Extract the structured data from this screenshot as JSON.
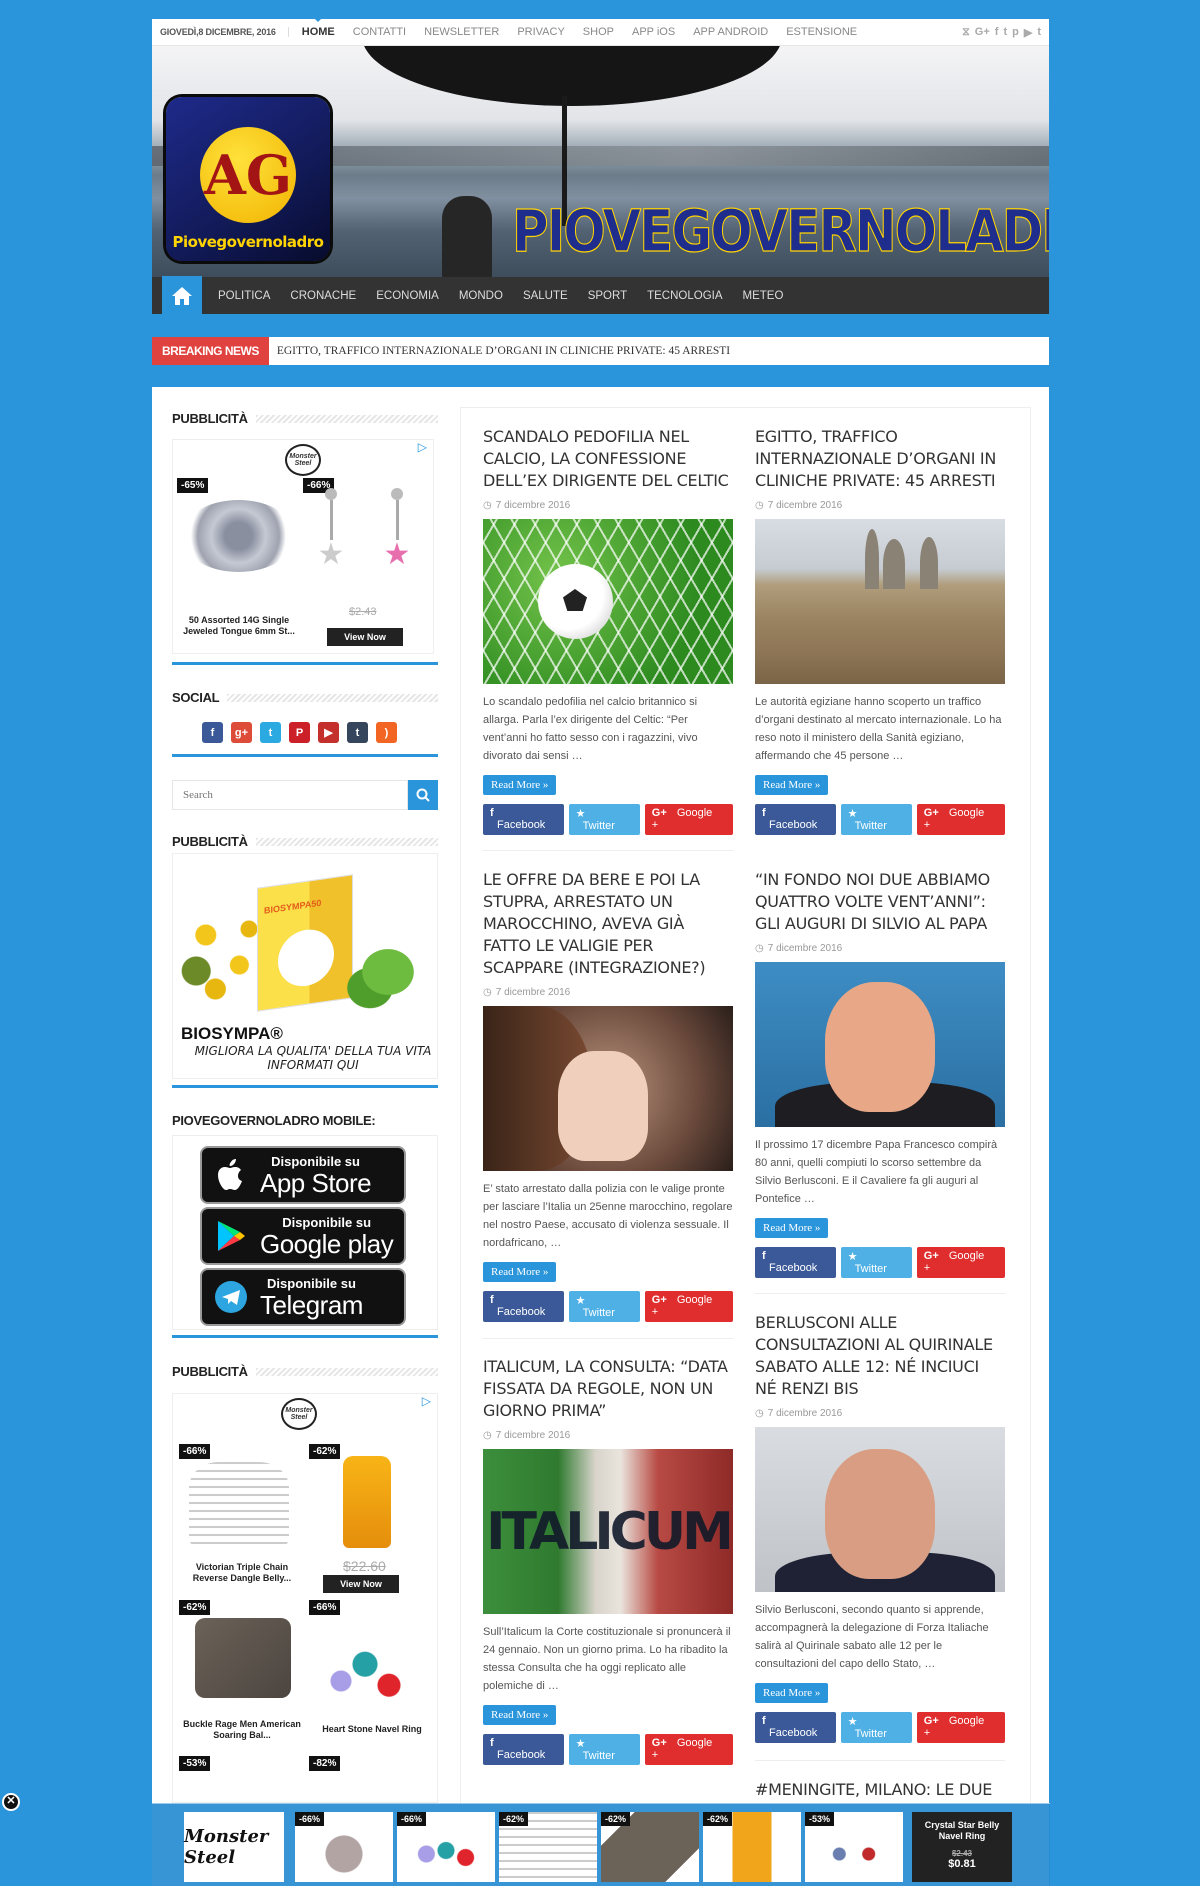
{
  "topbar": {
    "date": "GIOVEDÌ,8 DICEMBRE, 2016",
    "menu": [
      "HOME",
      "CONTATTI",
      "NEWSLETTER",
      "PRIVACY",
      "SHOP",
      "APP iOS",
      "APP ANDROID",
      "ESTENSIONE"
    ],
    "social_icons": [
      "rss-icon",
      "google-plus-icon",
      "facebook-icon",
      "twitter-icon",
      "pinterest-icon",
      "youtube-icon",
      "tumblr-icon"
    ]
  },
  "header": {
    "logo_letters": "AG",
    "logo_text": "Piovegovernoladro",
    "site_title": "PIOVEGOVERNOLADRO"
  },
  "nav": {
    "items": [
      "POLITICA",
      "CRONACHE",
      "ECONOMIA",
      "MONDO",
      "SALUTE",
      "SPORT",
      "TECNOLOGIA",
      "METEO"
    ]
  },
  "breaking": {
    "label": "BREAKING NEWS",
    "headline": "EGITTO, TRAFFICO INTERNAZIONALE D’ORGANI IN CLINICHE PRIVATE: 45 ARRESTI"
  },
  "sidebar": {
    "widget1_title": "PUBBLICITÀ",
    "ad1": {
      "brand": "Monster Steel",
      "products": [
        {
          "discount": "-65%",
          "caption": "50 Assorted 14G Single Jeweled Tongue 6mm St..."
        },
        {
          "discount": "-66%",
          "old_price": "$2.43",
          "button": "View Now"
        }
      ]
    },
    "social_title": "SOCIAL",
    "search_placeholder": "Search",
    "widget3_title": "PUBBLICITÀ",
    "ad2": {
      "box_brand": "BIOSYMPA50",
      "name": "BIOSYMPA®",
      "tagline": "MIGLIORA LA QUALITA' DELLA TUA VITA INFORMATI QUI"
    },
    "mobile_title": "PIOVEGOVERNOLADRO MOBILE:",
    "stores": [
      {
        "small": "Disponibile su",
        "big": "App Store"
      },
      {
        "small": "Disponibile su",
        "big": "Google play"
      },
      {
        "small": "Disponibile su",
        "big": "Telegram"
      }
    ],
    "widget5_title": "PUBBLICITÀ",
    "ad3": {
      "brand": "Monster Steel",
      "products": [
        {
          "discount": "-66%",
          "caption": "Victorian Triple Chain Reverse Dangle Belly..."
        },
        {
          "discount": "-62%",
          "old_price": "$22.60",
          "button": "View Now"
        },
        {
          "discount": "-62%",
          "caption": "Buckle Rage Men American Soaring Bal..."
        },
        {
          "discount": "-66%",
          "caption": "Heart Stone Navel Ring"
        },
        {
          "discount": "-53%"
        },
        {
          "discount": "-82%"
        }
      ]
    }
  },
  "articles": [
    {
      "title": "SCANDALO PEDOFILIA NEL CALCIO, LA CONFESSIONE DELL’EX DIRIGENTE DEL CELTIC",
      "date": "7 dicembre 2016",
      "excerpt": "Lo scandalo pedofilia nel calcio britannico si allarga. Parla l’ex dirigente del Celtic: “Per vent’anni ho fatto sesso con i ragazzini, vivo divorato dai sensi …"
    },
    {
      "title": "EGITTO, TRAFFICO INTERNAZIONALE D’ORGANI IN CLINICHE PRIVATE: 45 ARRESTI",
      "date": "7 dicembre 2016",
      "excerpt": "Le autorità egiziane hanno scoperto un traffico d’organi destinato al mercato internazionale. Lo ha reso noto il ministero della Sanità egiziano, affermando che 45 persone …"
    },
    {
      "title": "LE OFFRE DA BERE E POI LA STUPRA, ARRESTATO UN MAROCCHINO, AVEVA GIÀ FATTO LE VALIGIE PER SCAPPARE (INTEGRAZIONE?)",
      "date": "7 dicembre 2016",
      "excerpt": "E’ stato arrestato dalla polizia con le valige pronte per lasciare l’Italia un 25enne marocchino, regolare nel nostro Paese, accusato di violenza sessuale. Il nordafricano, …"
    },
    {
      "title": "“IN FONDO NOI DUE ABBIAMO QUATTRO VOLTE VENT’ANNI”: GLI AUGURI DI SILVIO AL PAPA",
      "date": "7 dicembre 2016",
      "excerpt": "Il prossimo 17 dicembre Papa Francesco compirà 80 anni, quelli compiuti lo scorso settembre da Silvio Berlusconi. E il Cavaliere fa gli auguri al Pontefice …"
    },
    {
      "title": "ITALICUM, LA CONSULTA: “DATA FISSATA DA REGOLE, NON UN GIORNO PRIMA”",
      "date": "7 dicembre 2016",
      "image_text": "ITALICUM",
      "excerpt": "Sull’Italicum la Corte costituzionale si pronuncerà il 24 gennaio. Non un giorno prima. Lo ha ribadito la stessa Consulta che ha oggi replicato alle polemiche di …"
    },
    {
      "title": "BERLUSCONI ALLE CONSULTAZIONI AL QUIRINALE SABATO ALLE 12: NÉ INCIUCI NÉ RENZI BIS",
      "date": "7 dicembre 2016",
      "excerpt": "Silvio Berlusconi, secondo quanto si apprende, accompagnerà la delegazione di Forza Italiache salirà al Quirinale sabato alle 12 per le consultazioni del capo dello Stato, …"
    },
    {
      "title": "#MENINGITE, MILANO: LE DUE"
    }
  ],
  "buttons": {
    "read_more": "Read More »",
    "facebook": "Facebook",
    "twitter": "Twitter",
    "google": "Google +"
  },
  "bottom_ad": {
    "brand": "Monster Steel",
    "discounts": [
      "-66%",
      "-66%",
      "-62%",
      "-62%",
      "-62%",
      "-53%"
    ],
    "final_caption": "Crystal Star Belly Navel Ring",
    "final_old_price": "$2.43",
    "final_price": "$0.81"
  },
  "colors": {
    "accent": "#2a95db",
    "breaking": "#e0423f",
    "nav": "#333333",
    "facebook": "#3b5998",
    "twitter": "#4fb0e5",
    "google": "#e02d2d"
  }
}
